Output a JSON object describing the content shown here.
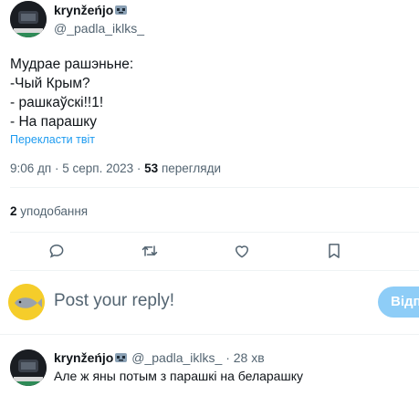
{
  "tweet": {
    "author_name": "krynžeńjo",
    "author_handle": "@_padla_iklks_",
    "lines": [
      "Мудрае рашэньне:",
      "-Чый Крым?",
      "- рашкаўскі!!1!",
      "- На парашку"
    ],
    "translate_label": "Перекласти твіт",
    "time": "9:06 дп",
    "date": "5 серп. 2023",
    "views_count": "53",
    "views_label": "перегляди",
    "likes_count": "2",
    "likes_label": "уподобання"
  },
  "actions": {
    "reply_icon": "reply-icon",
    "retweet_icon": "retweet-icon",
    "like_icon": "heart-icon",
    "bookmark_icon": "bookmark-icon"
  },
  "composer": {
    "placeholder": "Post your reply!",
    "button_label": "Відп"
  },
  "reply": {
    "author_name": "krynžeńjo",
    "author_handle": "@_padla_iklks_",
    "separator": "·",
    "time": "28 хв",
    "text": "Але ж яны потым з парашкі на беларашку"
  },
  "colors": {
    "accent": "#1d9bf0",
    "button_disabled": "#8ecdf7",
    "secondary_text": "#536471",
    "divider": "#eff3f4"
  }
}
